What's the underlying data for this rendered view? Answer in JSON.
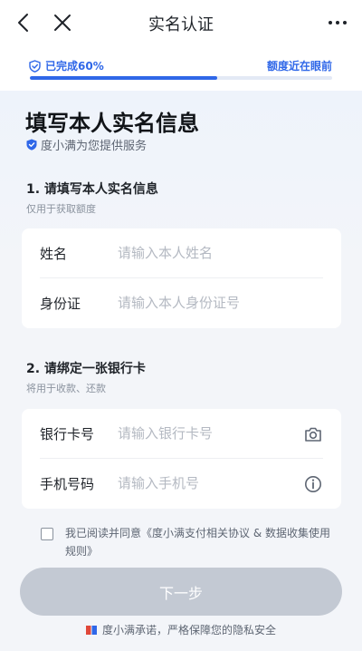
{
  "header": {
    "title": "实名认证"
  },
  "progress": {
    "status_label": "已完成60%",
    "fraction": 0.62,
    "right_label": "额度近在眼前"
  },
  "page": {
    "heading": "填写本人实名信息",
    "provider": "度小满为您提供服务"
  },
  "section1": {
    "title": "1. 请填写本人实名信息",
    "subtitle": "仅用于获取额度",
    "fields": [
      {
        "label": "姓名",
        "placeholder": "请输入本人姓名",
        "value": ""
      },
      {
        "label": "身份证",
        "placeholder": "请输入本人身份证号",
        "value": ""
      }
    ]
  },
  "section2": {
    "title": "2. 请绑定一张银行卡",
    "subtitle": "将用于收款、还款",
    "fields": [
      {
        "label": "银行卡号",
        "placeholder": "请输入银行卡号",
        "value": "",
        "icon": "camera-icon"
      },
      {
        "label": "手机号码",
        "placeholder": "请输入手机号",
        "value": "",
        "icon": "info-icon"
      }
    ]
  },
  "agreement": {
    "checked": false,
    "text": "我已阅读并同意《度小满支付相关协议 & 数据收集使用规则》"
  },
  "actions": {
    "next_label": "下一步"
  },
  "footer": {
    "promise": "度小满承诺，严格保障您的隐私安全"
  },
  "colors": {
    "brand": "#2f67e8",
    "button_disabled": "#c3c9d3",
    "background": "#f2f5fa"
  }
}
